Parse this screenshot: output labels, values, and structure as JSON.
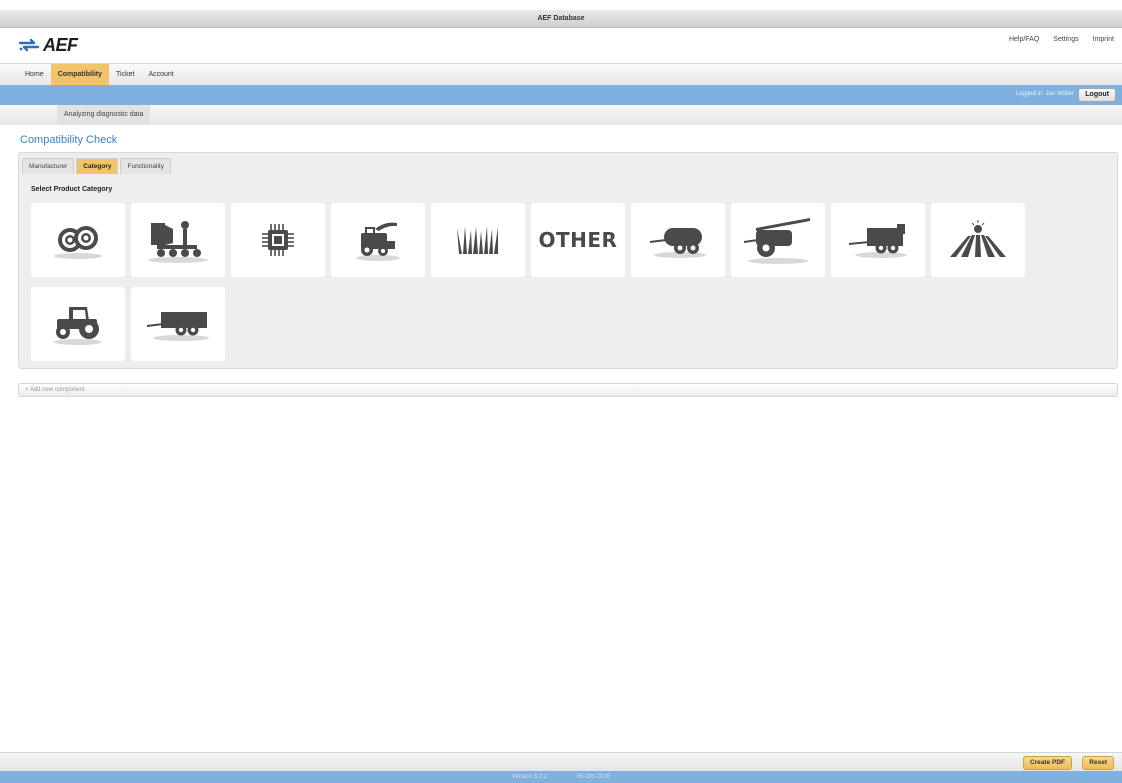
{
  "window": {
    "title": "AEF Database"
  },
  "logo": {
    "text": "AEF"
  },
  "toplinks": [
    "Help/FAQ",
    "Settings",
    "Imprint"
  ],
  "nav": {
    "tabs": [
      "Home",
      "Compatibility",
      "Ticket",
      "Account"
    ],
    "active": "Compatibility"
  },
  "session": {
    "logged_in": "Logged in: Jan Wöller",
    "logout": "Logout"
  },
  "subnav": {
    "item": "Analyzing diagnostic data"
  },
  "page": {
    "title": "Compatibility Check"
  },
  "panel": {
    "tabs": [
      "Manufacturer",
      "Category",
      "Functionality"
    ],
    "active_tab": "Category",
    "section_label": "Select Product Category",
    "categories": [
      {
        "icon": "baler-icon"
      },
      {
        "icon": "seeder-icon"
      },
      {
        "icon": "electronics-chip-icon"
      },
      {
        "icon": "forage-harvester-icon"
      },
      {
        "icon": "grass-icon"
      },
      {
        "icon": "other-icon",
        "text": "OTHER"
      },
      {
        "icon": "tank-trailer-icon"
      },
      {
        "icon": "sprayer-icon"
      },
      {
        "icon": "spreader-trailer-icon"
      },
      {
        "icon": "field-icon"
      },
      {
        "icon": "tractor-icon"
      },
      {
        "icon": "trailer-icon"
      }
    ]
  },
  "add_component": {
    "label": "+ Add new component"
  },
  "actions": {
    "create_pdf": "Create PDF",
    "reset": "Reset"
  },
  "footer": {
    "version": "Version 3.2.2",
    "date": "06-Oct-2016"
  },
  "colors": {
    "accent_yellow": "#f2c46a",
    "bar_blue": "#7fb0de",
    "title_blue": "#3a7fc1",
    "icon_grey": "#4a4a4a"
  }
}
